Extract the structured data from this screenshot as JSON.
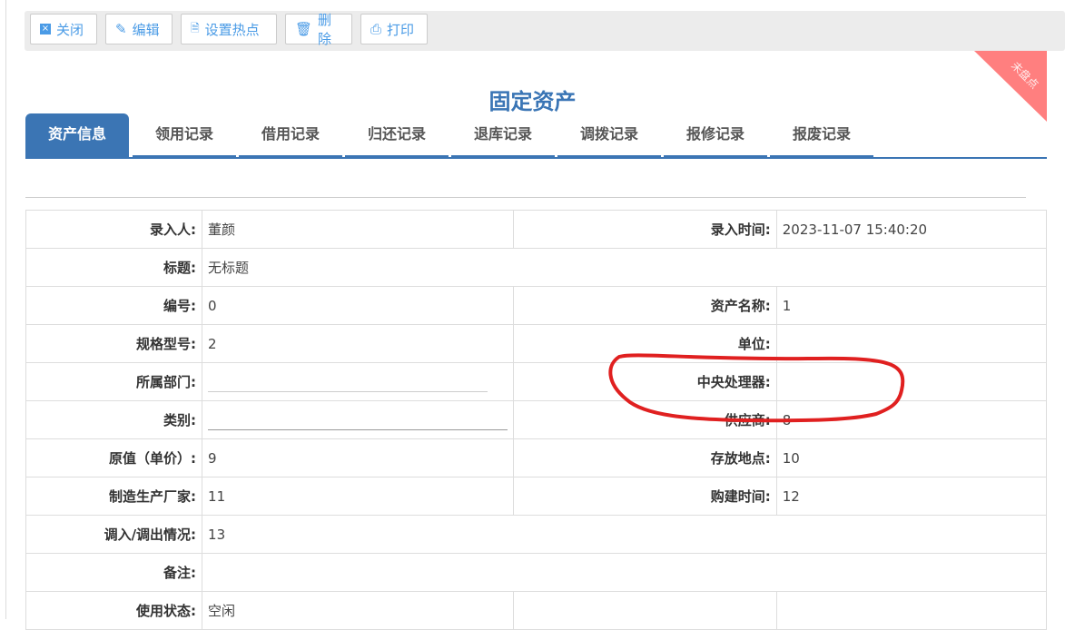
{
  "toolbar": {
    "buttons": [
      {
        "label": "关闭",
        "icon": "close-icon"
      },
      {
        "label": "编辑",
        "icon": "pencil-icon"
      },
      {
        "label": "设置热点",
        "icon": "fire-icon"
      },
      {
        "label": "删除",
        "icon": "trash-icon"
      },
      {
        "label": "打印",
        "icon": "printer-icon"
      }
    ]
  },
  "ribbon": "未盘点",
  "title": "固定资产",
  "tabs": [
    "资产信息",
    "领用记录",
    "借用记录",
    "归还记录",
    "退库记录",
    "调拨记录",
    "报修记录",
    "报废记录"
  ],
  "fields": {
    "entered_by_label": "录入人:",
    "entered_by": "董颜",
    "entered_time_label": "录入时间:",
    "entered_time": "2023-11-07 15:40:20",
    "title_label": "标题:",
    "title_value": "无标题",
    "code_label": "编号:",
    "code": "0",
    "asset_name_label": "资产名称:",
    "asset_name": "1",
    "spec_label": "规格型号:",
    "spec": "2",
    "unit_label": "单位:",
    "unit": "",
    "dept_label": "所属部门:",
    "cpu_label": "中央处理器:",
    "cpu": "",
    "category_label": "类别:",
    "supplier_label": "供应商:",
    "supplier": "8",
    "price_label": "原值（单价）:",
    "price": "9",
    "location_label": "存放地点:",
    "location": "10",
    "maker_label": "制造生产厂家:",
    "maker": "11",
    "purchase_time_label": "购建时间:",
    "purchase_time": "12",
    "transfer_label": "调入/调出情况:",
    "transfer": "13",
    "remark_label": "备注:",
    "remark": "",
    "status_label": "使用状态:",
    "status": "空闲"
  },
  "colors": {
    "accent": "#3b75b4",
    "annotation": "#e02020",
    "ribbon": "#ff7f7f"
  }
}
